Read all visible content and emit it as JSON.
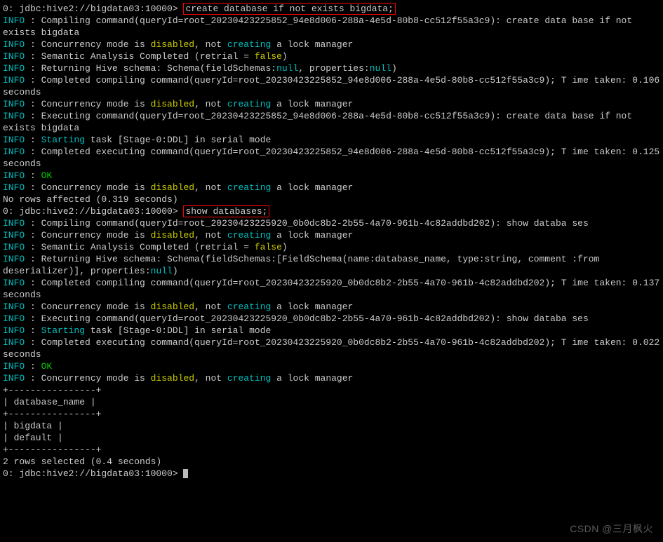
{
  "prompt1_prefix": "0: jdbc:hive2://bigdata03:10000> ",
  "cmd1": "create database if not exists bigdata;",
  "block1": [
    {
      "segments": [
        {
          "cls": "info",
          "text": "INFO"
        },
        {
          "cls": "white",
          "text": "  : Compiling command(queryId=root_20230423225852_94e8d006-288a-4e5d-80b8-cc512f55a3c9): create data base if not exists bigdata"
        }
      ]
    },
    {
      "segments": [
        {
          "cls": "info",
          "text": "INFO"
        },
        {
          "cls": "white",
          "text": "  : Concurrency mode is "
        },
        {
          "cls": "yellow",
          "text": "disabled"
        },
        {
          "cls": "white",
          "text": ", not "
        },
        {
          "cls": "cyan",
          "text": "creating"
        },
        {
          "cls": "white",
          "text": " a lock manager"
        }
      ]
    },
    {
      "segments": [
        {
          "cls": "info",
          "text": "INFO"
        },
        {
          "cls": "white",
          "text": "  : Semantic Analysis Completed (retrial = "
        },
        {
          "cls": "yellow",
          "text": "false"
        },
        {
          "cls": "white",
          "text": ")"
        }
      ]
    },
    {
      "segments": [
        {
          "cls": "info",
          "text": "INFO"
        },
        {
          "cls": "white",
          "text": "  : Returning Hive schema: Schema(fieldSchemas:"
        },
        {
          "cls": "cyan",
          "text": "null"
        },
        {
          "cls": "white",
          "text": ", properties:"
        },
        {
          "cls": "cyan",
          "text": "null"
        },
        {
          "cls": "white",
          "text": ")"
        }
      ]
    },
    {
      "segments": [
        {
          "cls": "info",
          "text": "INFO"
        },
        {
          "cls": "white",
          "text": "  : Completed compiling command(queryId=root_20230423225852_94e8d006-288a-4e5d-80b8-cc512f55a3c9); T ime taken: 0.106 seconds"
        }
      ]
    },
    {
      "segments": [
        {
          "cls": "info",
          "text": "INFO"
        },
        {
          "cls": "white",
          "text": "  : Concurrency mode is "
        },
        {
          "cls": "yellow",
          "text": "disabled"
        },
        {
          "cls": "white",
          "text": ", not "
        },
        {
          "cls": "cyan",
          "text": "creating"
        },
        {
          "cls": "white",
          "text": " a lock manager"
        }
      ]
    },
    {
      "segments": [
        {
          "cls": "info",
          "text": "INFO"
        },
        {
          "cls": "white",
          "text": "  : Executing command(queryId=root_20230423225852_94e8d006-288a-4e5d-80b8-cc512f55a3c9): create data base if not exists bigdata"
        }
      ]
    },
    {
      "segments": [
        {
          "cls": "info",
          "text": "INFO"
        },
        {
          "cls": "white",
          "text": "  : "
        },
        {
          "cls": "cyan",
          "text": "Starting"
        },
        {
          "cls": "white",
          "text": " task [Stage-0:DDL] in serial mode"
        }
      ]
    },
    {
      "segments": [
        {
          "cls": "info",
          "text": "INFO"
        },
        {
          "cls": "white",
          "text": "  : Completed executing command(queryId=root_20230423225852_94e8d006-288a-4e5d-80b8-cc512f55a3c9); T ime taken: 0.125 seconds"
        }
      ]
    },
    {
      "segments": [
        {
          "cls": "info",
          "text": "INFO"
        },
        {
          "cls": "white",
          "text": "  : "
        },
        {
          "cls": "green",
          "text": "OK"
        }
      ]
    },
    {
      "segments": [
        {
          "cls": "info",
          "text": "INFO"
        },
        {
          "cls": "white",
          "text": "  : Concurrency mode is "
        },
        {
          "cls": "yellow",
          "text": "disabled"
        },
        {
          "cls": "white",
          "text": ", not "
        },
        {
          "cls": "cyan",
          "text": "creating"
        },
        {
          "cls": "white",
          "text": " a lock manager"
        }
      ]
    },
    {
      "segments": [
        {
          "cls": "white",
          "text": "No rows affected (0.319 seconds)"
        }
      ]
    }
  ],
  "prompt2_prefix": "0: jdbc:hive2://bigdata03:10000> ",
  "cmd2": "show databases;",
  "block2": [
    {
      "segments": [
        {
          "cls": "info",
          "text": "INFO"
        },
        {
          "cls": "white",
          "text": "  : Compiling command(queryId=root_20230423225920_0b0dc8b2-2b55-4a70-961b-4c82addbd202): show databa ses"
        }
      ]
    },
    {
      "segments": [
        {
          "cls": "info",
          "text": "INFO"
        },
        {
          "cls": "white",
          "text": "  : Concurrency mode is "
        },
        {
          "cls": "yellow",
          "text": "disabled"
        },
        {
          "cls": "white",
          "text": ", not "
        },
        {
          "cls": "cyan",
          "text": "creating"
        },
        {
          "cls": "white",
          "text": " a lock manager"
        }
      ]
    },
    {
      "segments": [
        {
          "cls": "info",
          "text": "INFO"
        },
        {
          "cls": "white",
          "text": "  : Semantic Analysis Completed (retrial = "
        },
        {
          "cls": "yellow",
          "text": "false"
        },
        {
          "cls": "white",
          "text": ")"
        }
      ]
    },
    {
      "segments": [
        {
          "cls": "info",
          "text": "INFO"
        },
        {
          "cls": "white",
          "text": "  : Returning Hive schema: Schema(fieldSchemas:[FieldSchema(name:database_name, type:string, comment :from deserializer)], properties:"
        },
        {
          "cls": "cyan",
          "text": "null"
        },
        {
          "cls": "white",
          "text": ")"
        }
      ]
    },
    {
      "segments": [
        {
          "cls": "info",
          "text": "INFO"
        },
        {
          "cls": "white",
          "text": "  : Completed compiling command(queryId=root_20230423225920_0b0dc8b2-2b55-4a70-961b-4c82addbd202); T ime taken: 0.137 seconds"
        }
      ]
    },
    {
      "segments": [
        {
          "cls": "info",
          "text": "INFO"
        },
        {
          "cls": "white",
          "text": "  : Concurrency mode is "
        },
        {
          "cls": "yellow",
          "text": "disabled"
        },
        {
          "cls": "white",
          "text": ", not "
        },
        {
          "cls": "cyan",
          "text": "creating"
        },
        {
          "cls": "white",
          "text": " a lock manager"
        }
      ]
    },
    {
      "segments": [
        {
          "cls": "info",
          "text": "INFO"
        },
        {
          "cls": "white",
          "text": "  : Executing command(queryId=root_20230423225920_0b0dc8b2-2b55-4a70-961b-4c82addbd202): show databa ses"
        }
      ]
    },
    {
      "segments": [
        {
          "cls": "info",
          "text": "INFO"
        },
        {
          "cls": "white",
          "text": "  : "
        },
        {
          "cls": "cyan",
          "text": "Starting"
        },
        {
          "cls": "white",
          "text": " task [Stage-0:DDL] in serial mode"
        }
      ]
    },
    {
      "segments": [
        {
          "cls": "info",
          "text": "INFO"
        },
        {
          "cls": "white",
          "text": "  : Completed executing command(queryId=root_20230423225920_0b0dc8b2-2b55-4a70-961b-4c82addbd202); T ime taken: 0.022 seconds"
        }
      ]
    },
    {
      "segments": [
        {
          "cls": "info",
          "text": "INFO"
        },
        {
          "cls": "white",
          "text": "  : "
        },
        {
          "cls": "green",
          "text": "OK"
        }
      ]
    },
    {
      "segments": [
        {
          "cls": "info",
          "text": "INFO"
        },
        {
          "cls": "white",
          "text": "  : Concurrency mode is "
        },
        {
          "cls": "yellow",
          "text": "disabled"
        },
        {
          "cls": "white",
          "text": ", not "
        },
        {
          "cls": "cyan",
          "text": "creating"
        },
        {
          "cls": "white",
          "text": " a lock manager"
        }
      ]
    }
  ],
  "table": {
    "border": "+----------------+",
    "header": "| database_name  |",
    "rows": [
      "| bigdata        |",
      "| default        |"
    ],
    "footer": "2 rows selected (0.4 seconds)"
  },
  "prompt3": "0: jdbc:hive2://bigdata03:10000> ",
  "watermark": "CSDN @三月枫火"
}
